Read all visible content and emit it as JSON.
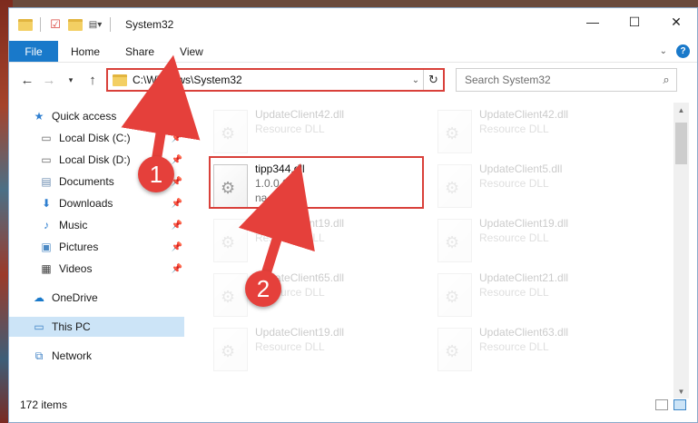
{
  "window": {
    "title": "System32",
    "controls": {
      "minimize": "—",
      "maximize": "☐",
      "close": "✕"
    }
  },
  "ribbon": {
    "tabs": [
      "File",
      "Home",
      "Share",
      "View"
    ],
    "help_icon": "?"
  },
  "navigation": {
    "address": "C:\\Windows\\System32",
    "search_placeholder": "Search System32"
  },
  "sidebar": {
    "items": [
      {
        "label": "Quick access",
        "icon": "star-icon",
        "pinned": false
      },
      {
        "label": "Local Disk (C:)",
        "icon": "drive-icon",
        "pinned": true
      },
      {
        "label": "Local Disk (D:)",
        "icon": "drive-icon",
        "pinned": true
      },
      {
        "label": "Documents",
        "icon": "documents-icon",
        "pinned": true
      },
      {
        "label": "Downloads",
        "icon": "download-icon",
        "pinned": true
      },
      {
        "label": "Music",
        "icon": "music-icon",
        "pinned": true
      },
      {
        "label": "Pictures",
        "icon": "pictures-icon",
        "pinned": true
      },
      {
        "label": "Videos",
        "icon": "videos-icon",
        "pinned": true
      },
      {
        "label": "OneDrive",
        "icon": "cloud-icon",
        "pinned": false
      },
      {
        "label": "This PC",
        "icon": "computer-icon",
        "pinned": false
      },
      {
        "label": "Network",
        "icon": "network-icon",
        "pinned": false
      }
    ]
  },
  "files": [
    {
      "name": "UpdateClient42.dll",
      "sub": "Resource DLL"
    },
    {
      "name": "UpdateClient42.dll",
      "sub": "Resource DLL"
    },
    {
      "name": "tipp344.dll",
      "sub": "1.0.0.0",
      "sub2": "na"
    },
    {
      "name": "UpdateClient5.dll",
      "sub": "Resource DLL"
    },
    {
      "name": "UpdateClient19.dll",
      "sub": "Resource DLL"
    },
    {
      "name": "UpdateClient19.dll",
      "sub": "Resource DLL"
    },
    {
      "name": "UpdateClient65.dll",
      "sub": "Resource DLL"
    },
    {
      "name": "UpdateClient21.dll",
      "sub": "Resource DLL"
    },
    {
      "name": "UpdateClient19.dll",
      "sub": "Resource DLL"
    },
    {
      "name": "UpdateClient63.dll",
      "sub": "Resource DLL"
    }
  ],
  "status": {
    "item_count": "172 items"
  },
  "annotations": {
    "step1": "1",
    "step2": "2"
  },
  "colors": {
    "accent": "#1979ca",
    "highlight": "#d9403a",
    "selected": "#cce4f7"
  }
}
